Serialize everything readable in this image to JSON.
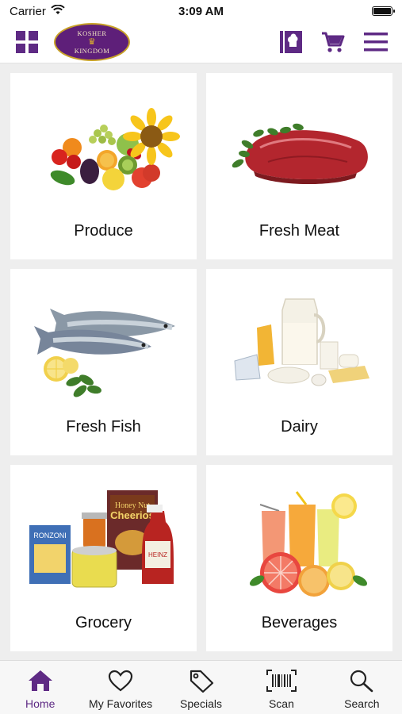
{
  "status_bar": {
    "carrier": "Carrier",
    "time": "3:09 AM"
  },
  "header": {
    "logo": {
      "line_top": "KOSHER",
      "line_bottom": "KINGDOM"
    },
    "icons": [
      "grid-menu-icon",
      "chef-card-icon",
      "cart-icon",
      "hamburger-menu-icon"
    ]
  },
  "categories": [
    {
      "label": "Produce",
      "icon": "produce-image"
    },
    {
      "label": "Fresh Meat",
      "icon": "meat-image"
    },
    {
      "label": "Fresh Fish",
      "icon": "fish-image"
    },
    {
      "label": "Dairy",
      "icon": "dairy-image"
    },
    {
      "label": "Grocery",
      "icon": "grocery-image"
    },
    {
      "label": "Beverages",
      "icon": "beverages-image"
    }
  ],
  "tabbar": {
    "active": "Home",
    "tabs": [
      {
        "label": "Home",
        "icon": "home-icon"
      },
      {
        "label": "My Favorites",
        "icon": "heart-icon"
      },
      {
        "label": "Specials",
        "icon": "tag-icon"
      },
      {
        "label": "Scan",
        "icon": "barcode-scan-icon"
      },
      {
        "label": "Search",
        "icon": "search-icon"
      }
    ]
  },
  "colors": {
    "brand_purple": "#5e2a84",
    "background": "#eeeeee",
    "tile": "#ffffff"
  }
}
